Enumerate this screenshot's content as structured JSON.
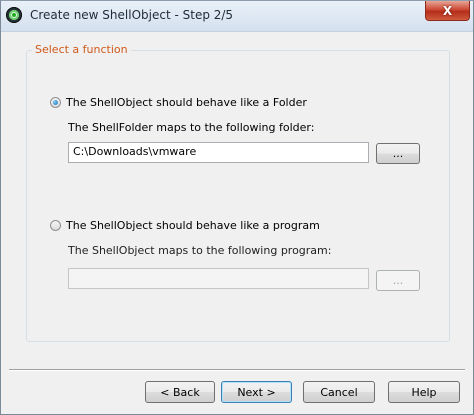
{
  "window": {
    "title": "Create new ShellObject - Step 2/5",
    "close_label": "X"
  },
  "group": {
    "legend": "Select a function"
  },
  "folder_option": {
    "label": "The ShellObject should behave like a Folder",
    "selected": true,
    "field_label": "The ShellFolder maps to the following folder:",
    "path_value": "C:\\Downloads\\vmware",
    "browse_label": "...",
    "enabled": true
  },
  "program_option": {
    "label": "The ShellObject should behave like a program",
    "selected": false,
    "field_label": "The ShellObject maps to the following program:",
    "path_value": "",
    "browse_label": "...",
    "enabled": false
  },
  "footer": {
    "back_label": "< Back",
    "next_label": "Next >",
    "cancel_label": "Cancel",
    "help_label": "Help"
  },
  "colors": {
    "legend": "#d05a1a",
    "dialog_bg": "#f0f0f0",
    "close_button": "#c9462f"
  }
}
